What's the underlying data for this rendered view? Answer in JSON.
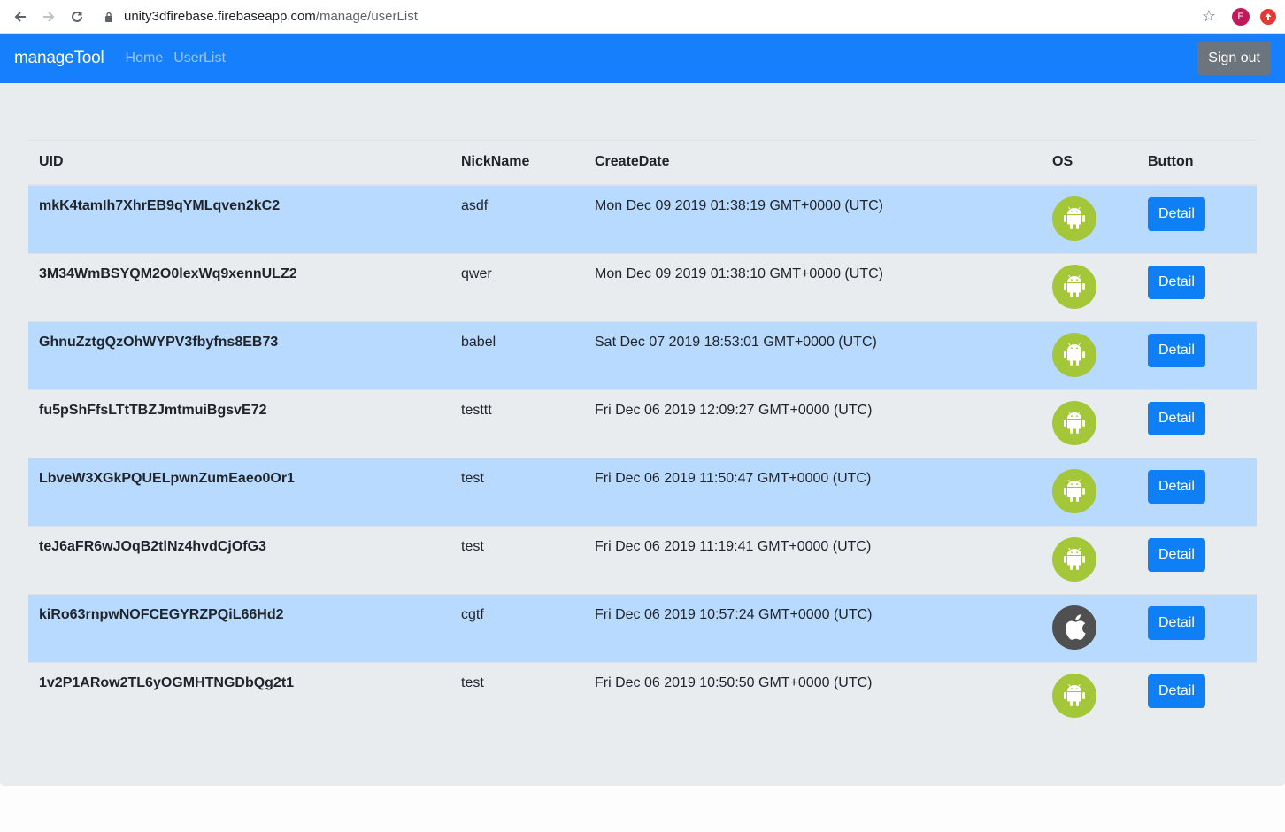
{
  "browser": {
    "url_host": "unity3dfirebase.firebaseapp.com",
    "url_path": "/manage/userList",
    "profile_initial": "E"
  },
  "navbar": {
    "brand": "manageTool",
    "links": [
      "Home",
      "UserList"
    ],
    "signout_label": "Sign out",
    "color": "#167ffc"
  },
  "table": {
    "headers": [
      "UID",
      "NickName",
      "CreateDate",
      "OS",
      "Button"
    ],
    "rows": [
      {
        "uid": "mkK4tamIh7XhrEB9qYMLqven2kC2",
        "nick": "asdf",
        "date": "Mon Dec 09 2019 01:38:19 GMT+0000 (UTC)",
        "os": "android-icon",
        "button": "Detail"
      },
      {
        "uid": "3M34WmBSYQM2O0lexWq9xennULZ2",
        "nick": "qwer",
        "date": "Mon Dec 09 2019 01:38:10 GMT+0000 (UTC)",
        "os": "android-icon",
        "button": "Detail"
      },
      {
        "uid": "GhnuZztgQzOhWYPV3fbyfns8EB73",
        "nick": "babel",
        "date": "Sat Dec 07 2019 18:53:01 GMT+0000 (UTC)",
        "os": "android-icon",
        "button": "Detail"
      },
      {
        "uid": "fu5pShFfsLTtTBZJmtmuiBgsvE72",
        "nick": "testtt",
        "date": "Fri Dec 06 2019 12:09:27 GMT+0000 (UTC)",
        "os": "android-icon",
        "button": "Detail"
      },
      {
        "uid": "LbveW3XGkPQUELpwnZumEaeo0Or1",
        "nick": "test",
        "date": "Fri Dec 06 2019 11:50:47 GMT+0000 (UTC)",
        "os": "android-icon",
        "button": "Detail"
      },
      {
        "uid": "teJ6aFR6wJOqB2tlNz4hvdCjOfG3",
        "nick": "test",
        "date": "Fri Dec 06 2019 11:19:41 GMT+0000 (UTC)",
        "os": "android-icon",
        "button": "Detail"
      },
      {
        "uid": "kiRo63rnpwNOFCEGYRZPQiL66Hd2",
        "nick": "cgtf",
        "date": "Fri Dec 06 2019 10:57:24 GMT+0000 (UTC)",
        "os": "apple-icon",
        "button": "Detail"
      },
      {
        "uid": "1v2P1ARow2TL6yOGMHTNGDbQg2t1",
        "nick": "test",
        "date": "Fri Dec 06 2019 10:50:50 GMT+0000 (UTC)",
        "os": "android-icon",
        "button": "Detail"
      }
    ]
  },
  "colors": {
    "striped_row": "#b8daff",
    "android": "#a4c639",
    "ios": "#505050",
    "detail_button": "#0f7ff5"
  }
}
